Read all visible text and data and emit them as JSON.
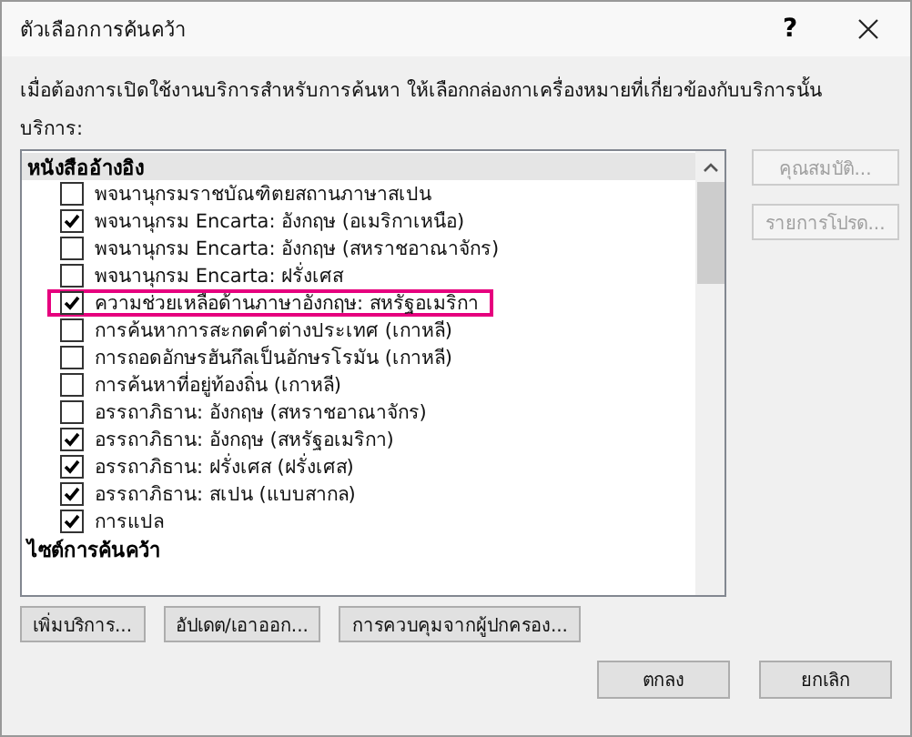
{
  "window": {
    "title": "ตัวเลือกการค้นคว้า",
    "help": "?"
  },
  "description": "เมื่อต้องการเปิดใช้งานบริการสำหรับการค้นหา ให้เลือกกล่องกาเครื่องหมายที่เกี่ยวข้องกับบริการนั้น",
  "services_label": "บริการ:",
  "services": [
    {
      "kind": "group",
      "label": "หนังสืออ้างอิง",
      "selected": true
    },
    {
      "kind": "item",
      "label": "พจนานุกรมราชบัณฑิตยสถานภาษาสเปน",
      "checked": false,
      "highlighted": false
    },
    {
      "kind": "item",
      "label": "พจนานุกรม Encarta: อังกฤษ (อเมริกาเหนือ)",
      "checked": true,
      "highlighted": false
    },
    {
      "kind": "item",
      "label": "พจนานุกรม Encarta: อังกฤษ (สหราชอาณาจักร)",
      "checked": false,
      "highlighted": false
    },
    {
      "kind": "item",
      "label": "พจนานุกรม Encarta: ฝรั่งเศส",
      "checked": false,
      "highlighted": false
    },
    {
      "kind": "item",
      "label": "ความช่วยเหลือด้านภาษาอังกฤษ: สหรัฐอเมริกา",
      "checked": true,
      "highlighted": true
    },
    {
      "kind": "item",
      "label": "การค้นหาการสะกดคำต่างประเทศ (เกาหลี)",
      "checked": false,
      "highlighted": false
    },
    {
      "kind": "item",
      "label": "การถอดอักษรฮันกึลเป็นอักษรโรมัน (เกาหลี)",
      "checked": false,
      "highlighted": false
    },
    {
      "kind": "item",
      "label": "การค้นหาที่อยู่ท้องถิ่น (เกาหลี)",
      "checked": false,
      "highlighted": false
    },
    {
      "kind": "item",
      "label": "อรรถาภิธาน: อังกฤษ (สหราชอาณาจักร)",
      "checked": false,
      "highlighted": false
    },
    {
      "kind": "item",
      "label": "อรรถาภิธาน: อังกฤษ (สหรัฐอเมริกา)",
      "checked": true,
      "highlighted": false
    },
    {
      "kind": "item",
      "label": "อรรถาภิธาน: ฝรั่งเศส (ฝรั่งเศส)",
      "checked": true,
      "highlighted": false
    },
    {
      "kind": "item",
      "label": "อรรถาภิธาน: สเปน (แบบสากล)",
      "checked": true,
      "highlighted": false
    },
    {
      "kind": "item",
      "label": "การแปล",
      "checked": true,
      "highlighted": false
    },
    {
      "kind": "group",
      "label": "ไซต์การค้นคว้า",
      "selected": false
    }
  ],
  "side_buttons": [
    {
      "label": "คุณสมบัติ...",
      "disabled": true
    },
    {
      "label": "รายการโปรด...",
      "disabled": true
    }
  ],
  "bottom_buttons": [
    {
      "label": "เพิ่มบริการ..."
    },
    {
      "label": "อัปเดต/เอาออก..."
    },
    {
      "label": "การควบคุมจากผู้ปกครอง..."
    }
  ],
  "dialog_buttons": [
    {
      "label": "ตกลง"
    },
    {
      "label": "ยกเลิก"
    }
  ]
}
